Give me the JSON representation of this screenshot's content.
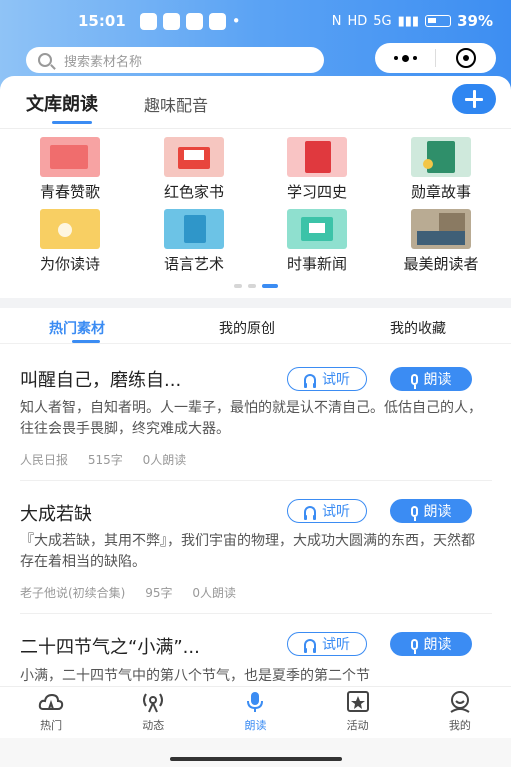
{
  "status": {
    "time": "15:01",
    "battery": "39%",
    "network": "5G"
  },
  "search": {
    "placeholder": "搜索素材名称"
  },
  "main_tabs": [
    {
      "label": "文库朗读"
    },
    {
      "label": "趣味配音"
    }
  ],
  "categories": [
    {
      "label": "青春赞歌",
      "icon": "youth-book-icon",
      "color": "#f47c7c"
    },
    {
      "label": "红色家书",
      "icon": "red-letter-icon",
      "color": "#e8453c"
    },
    {
      "label": "学习四史",
      "icon": "history-book-icon",
      "color": "#e0393e"
    },
    {
      "label": "勋章故事",
      "icon": "medal-book-icon",
      "color": "#2f8f6a"
    },
    {
      "label": "为你读诗",
      "icon": "poetry-icon",
      "color": "#f3b73c"
    },
    {
      "label": "语言艺术",
      "icon": "notebook-icon",
      "color": "#31a6d6"
    },
    {
      "label": "时事新闻",
      "icon": "news-icon",
      "color": "#3cc3a8"
    },
    {
      "label": "最美朗读者",
      "icon": "reader-photo-icon",
      "color": "#8a7a62"
    }
  ],
  "section_tabs": [
    {
      "label": "热门素材"
    },
    {
      "label": "我的原创"
    },
    {
      "label": "我的收藏"
    }
  ],
  "buttons": {
    "listen": "试听",
    "read": "朗读"
  },
  "items": [
    {
      "title": "叫醒自己，磨练自...",
      "desc": "知人者智，自知者明。人一辈子，最怕的就是认不清自己。低估自己的人，往往会畏手畏脚，终究难成大器。",
      "source": "人民日报",
      "words": "515字",
      "readers": "0人朗读"
    },
    {
      "title": "大成若缺",
      "desc": "『大成若缺，其用不弊』，我们宇宙的物理，大成功大圆满的东西，天然都存在着相当的缺陷。",
      "source": "老子他说(初续合集)",
      "words": "95字",
      "readers": "0人朗读"
    },
    {
      "title": "二十四节气之“小满”...",
      "desc": "小满，二十四节气中的第八个节气，也是夏季的第二个节",
      "source": "",
      "words": "",
      "readers": ""
    }
  ],
  "nav": [
    {
      "label": "热门",
      "icon": "hot-cloud-icon"
    },
    {
      "label": "动态",
      "icon": "broadcast-icon"
    },
    {
      "label": "朗读",
      "icon": "microphone-icon"
    },
    {
      "label": "活动",
      "icon": "star-badge-icon"
    },
    {
      "label": "我的",
      "icon": "profile-icon"
    }
  ],
  "accent": "#3b8cf3"
}
